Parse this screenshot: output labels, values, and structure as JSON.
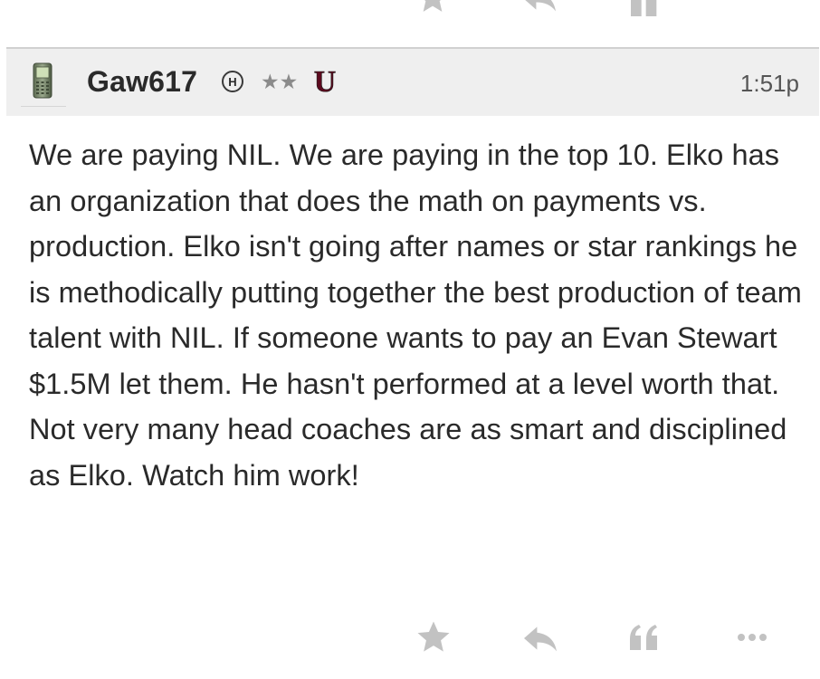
{
  "post": {
    "username": "Gaw617",
    "badge": "H",
    "stars": "★★",
    "team_logo": "U",
    "time": "1:51p",
    "body": "We are paying NIL. We are paying in the top 10. Elko has an organization that does the math on payments vs. production. Elko isn't going after names or star rankings he is methodically putting together the best production of team talent with NIL. If someone wants to pay an Evan Stewart $1.5M let them. He hasn't performed at a level worth that. Not very many head coaches are as smart and disciplined as Elko. Watch him work!"
  },
  "actions": {
    "icons": [
      "star-icon",
      "reply-icon",
      "quote-icon",
      "more-icon"
    ]
  },
  "colors": {
    "header_bg": "#efefef",
    "icon_gray": "#c2c2c2",
    "text": "#2a2a2a",
    "logo_maroon": "#5c0a1e"
  }
}
